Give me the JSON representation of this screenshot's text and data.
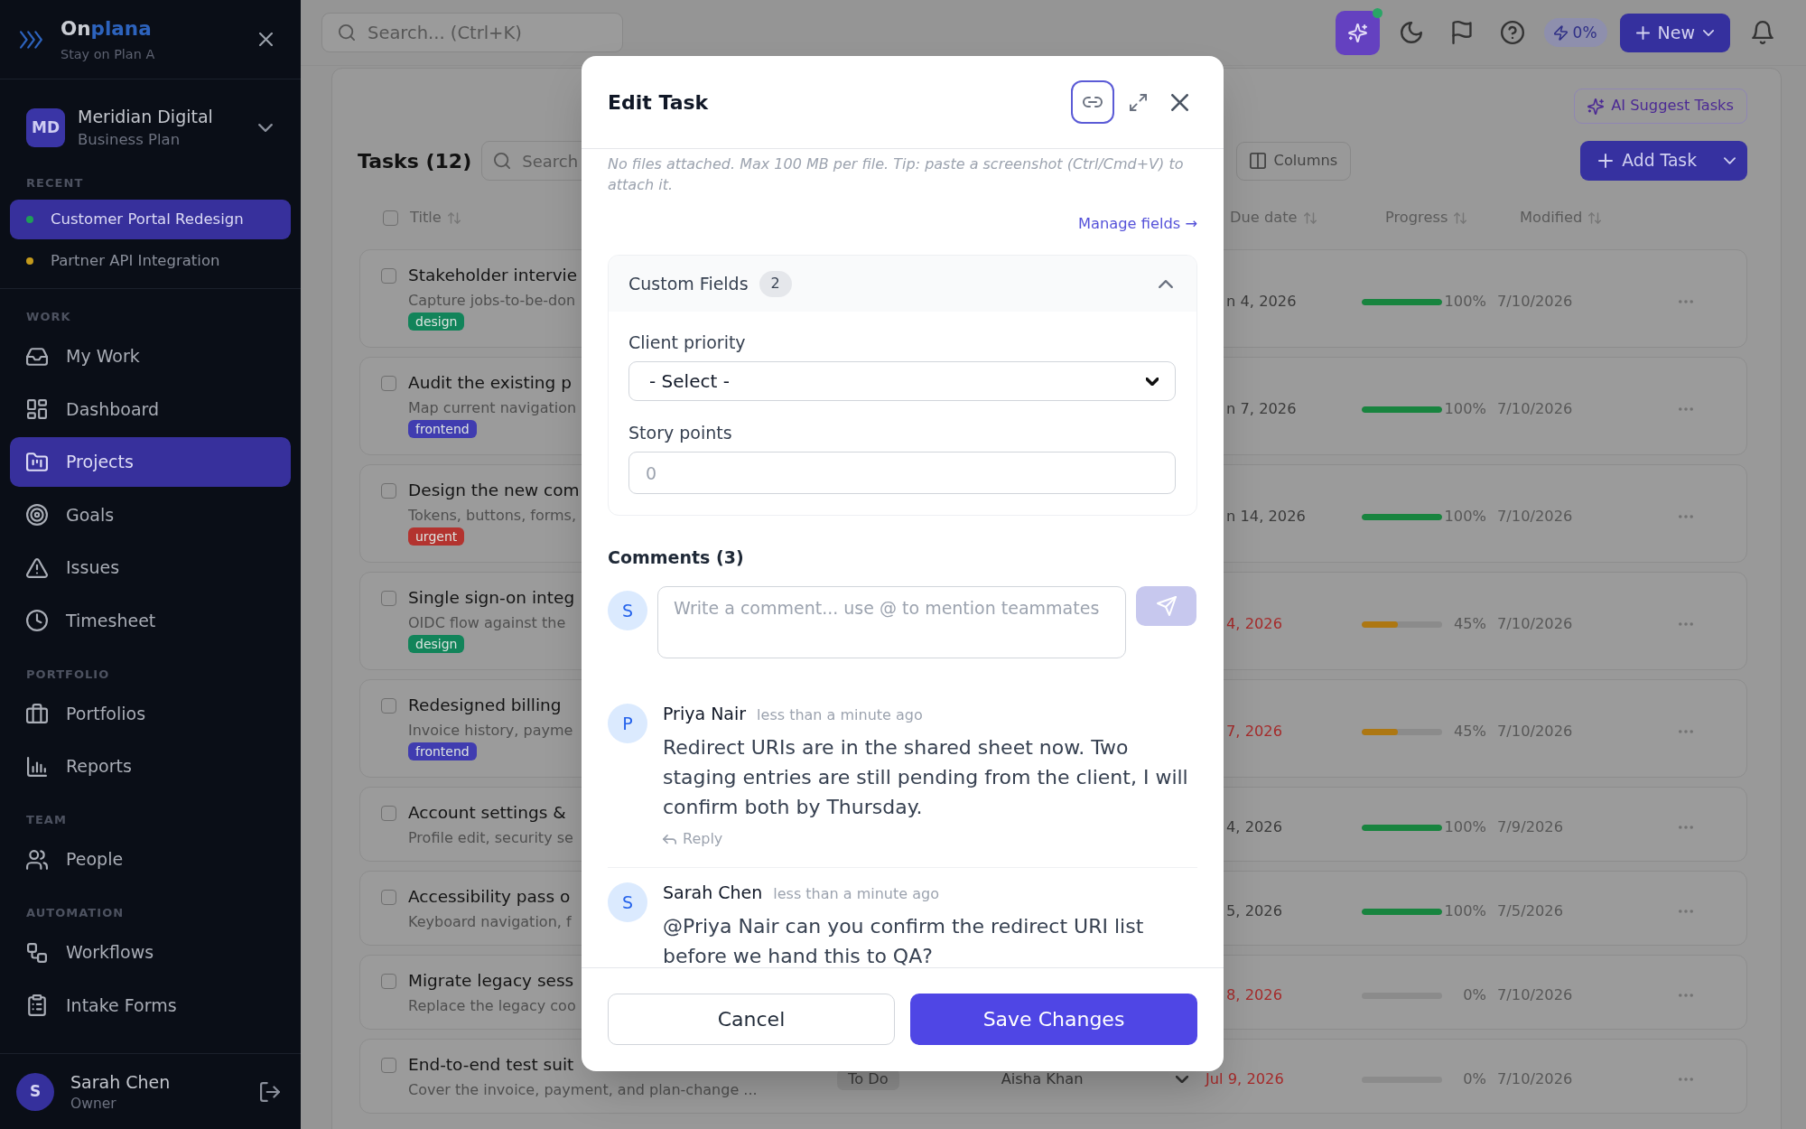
{
  "sidebar": {
    "brand": {
      "name_parts": [
        {
          "text": "On",
          "accent": false
        },
        {
          "text": "plana",
          "accent": true
        }
      ],
      "tagline": "Stay on Plan A"
    },
    "workspace": {
      "initials": "MD",
      "name": "Meridian Digital",
      "plan": "Business Plan"
    },
    "recent": {
      "label": "RECENT",
      "items": [
        {
          "label": "Customer Portal Redesign",
          "color": "#1f9d58",
          "selected": true
        },
        {
          "label": "Partner API Integration",
          "color": "#c49a1c",
          "selected": false
        }
      ]
    },
    "sections": [
      {
        "label": "WORK",
        "items": [
          {
            "label": "My Work",
            "selected": false
          },
          {
            "label": "Dashboard",
            "selected": false
          },
          {
            "label": "Projects",
            "selected": true
          },
          {
            "label": "Goals",
            "selected": false
          },
          {
            "label": "Issues",
            "selected": false
          },
          {
            "label": "Timesheet",
            "selected": false
          }
        ]
      },
      {
        "label": "PORTFOLIO",
        "items": [
          {
            "label": "Portfolios",
            "selected": false
          },
          {
            "label": "Reports",
            "selected": false
          }
        ]
      },
      {
        "label": "TEAM",
        "items": [
          {
            "label": "People",
            "selected": false
          }
        ]
      },
      {
        "label": "AUTOMATION",
        "items": [
          {
            "label": "Workflows",
            "selected": false
          },
          {
            "label": "Intake Forms",
            "selected": false
          }
        ]
      }
    ],
    "user": {
      "initial": "S",
      "name": "Sarah Chen",
      "role": "Owner"
    }
  },
  "topbar": {
    "search": {
      "placeholder": "Search... (Ctrl+K)"
    },
    "ai_button": {
      "notification": true
    },
    "usage_badge": "0%",
    "new_button": "New"
  },
  "tasks": {
    "ai_suggest_button": "AI Suggest Tasks",
    "title": "Tasks (12)",
    "search": {
      "placeholder": "Search"
    },
    "columns_button": "Columns",
    "add_button": "Add Task",
    "all_checked": false,
    "columns": [
      "Title",
      "Due date",
      "Progress",
      "Modified"
    ],
    "rows": [
      {
        "title": "Stakeholder intervie",
        "description": "Capture jobs-to-be-don",
        "tags": [
          {
            "label": "design",
            "color": "#12845a"
          }
        ],
        "checked": false,
        "due": "n 4, 2026",
        "overdue": false,
        "level": 1,
        "progress": "100%",
        "modified": "7/10/2026"
      },
      {
        "title": "Audit the existing p",
        "description": "Map current navigation",
        "tags": [
          {
            "label": "frontend",
            "color": "#403cb0"
          }
        ],
        "checked": false,
        "due": "n 7, 2026",
        "overdue": false,
        "level": 1,
        "progress": "100%",
        "modified": "7/10/2026"
      },
      {
        "title": "Design the new com",
        "description": "Tokens, buttons, forms,",
        "tags": [
          {
            "label": "urgent",
            "color": "#b3332f"
          }
        ],
        "checked": false,
        "due": "n 14, 2026",
        "overdue": false,
        "level": 1,
        "progress": "100%",
        "modified": "7/10/2026"
      },
      {
        "title": "Single sign-on integ",
        "description": "OIDC flow against the",
        "tags": [
          {
            "label": "design",
            "color": "#12845a"
          }
        ],
        "checked": false,
        "due": "4, 2026",
        "overdue": true,
        "level": 0.45,
        "progress": "45%",
        "modified": "7/10/2026"
      },
      {
        "title": "Redesigned billing",
        "description": "Invoice history, payme",
        "tags": [
          {
            "label": "frontend",
            "color": "#403cb0"
          }
        ],
        "checked": false,
        "due": "7, 2026",
        "overdue": true,
        "level": 0.45,
        "progress": "45%",
        "modified": "7/10/2026"
      },
      {
        "title": "Account settings &",
        "description": "Profile edit, security se",
        "checked": false,
        "due": "4, 2026",
        "overdue": false,
        "level": 1,
        "progress": "100%",
        "modified": "7/9/2026"
      },
      {
        "title": "Accessibility pass o",
        "description": "Keyboard navigation, f",
        "checked": false,
        "due": "5, 2026",
        "overdue": false,
        "level": 1,
        "progress": "100%",
        "modified": "7/5/2026"
      },
      {
        "title": "Migrate legacy sess",
        "description": "Replace the legacy coo",
        "checked": false,
        "due": "8, 2026",
        "overdue": true,
        "level": 0,
        "progress": "0%",
        "modified": "7/10/2026"
      },
      {
        "title": "End-to-end test suit",
        "description": "Cover the invoice, payment, and plan-change ...",
        "checked": false,
        "status": "To Do",
        "assignee": "Aisha Khan",
        "due": "Jul 9, 2026",
        "overdue": true,
        "level": 0,
        "progress": "0%",
        "modified": "7/10/2026"
      }
    ]
  },
  "modal": {
    "title": "Edit Task",
    "link_button": {
      "focused": true
    },
    "attachments_note": "No files attached. Max 100 MB per file. Tip: paste a screenshot (Ctrl/Cmd+V) to attach it.",
    "manage_fields_link": "Manage fields →",
    "custom_fields": {
      "title": "Custom Fields",
      "count": "2",
      "expanded": true,
      "fields": [
        {
          "kind": "select",
          "label": "Client priority",
          "value": "- Select -"
        },
        {
          "kind": "number",
          "label": "Story points",
          "placeholder": "0"
        }
      ]
    },
    "comments": {
      "title": "Comments (3)",
      "composer": {
        "avatar": "S",
        "placeholder": "Write a comment... use @ to mention teammates",
        "send_disabled": true
      },
      "items": [
        {
          "avatar": "P",
          "author": "Priya Nair",
          "time": "less than a minute ago",
          "text": "Redirect URIs are in the shared sheet now. Two staging entries are still pending from the client, I will confirm both by Thursday.",
          "reply": "Reply"
        },
        {
          "avatar": "S",
          "author": "Sarah Chen",
          "time": "less than a minute ago",
          "text": "@Priya Nair can you confirm the redirect URI list before we hand this to QA?"
        }
      ]
    },
    "cancel_button": "Cancel",
    "save_button": "Save Changes"
  }
}
